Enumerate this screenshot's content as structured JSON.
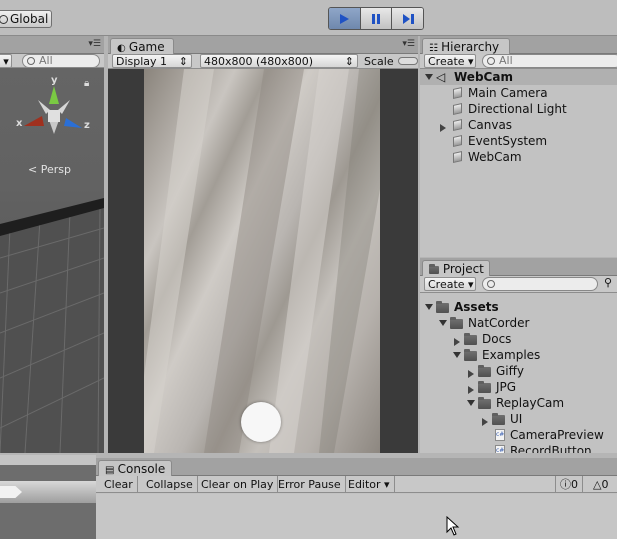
{
  "toolbar": {
    "global_label": "Global",
    "play_icon": "play-icon",
    "pause_icon": "pause-icon",
    "step_icon": "step-icon",
    "play_active_color": "#6f88ad"
  },
  "scene": {
    "search_placeholder": "All",
    "gizmo_axes": {
      "y": "y",
      "x": "x",
      "z": "z"
    },
    "projection_label": "Persp"
  },
  "game": {
    "tab_label": "Game",
    "display_value": "Display 1",
    "resolution_value": "480x800 (480x800)",
    "scale_label": "Scale"
  },
  "hierarchy": {
    "tab_label": "Hierarchy",
    "create_label": "Create",
    "search_placeholder": "All",
    "scene_name": "WebCam",
    "items": [
      {
        "label": "Main Camera",
        "expandable": false
      },
      {
        "label": "Directional Light",
        "expandable": false
      },
      {
        "label": "Canvas",
        "expandable": true
      },
      {
        "label": "EventSystem",
        "expandable": false
      },
      {
        "label": "WebCam",
        "expandable": false
      }
    ]
  },
  "project": {
    "tab_label": "Project",
    "create_label": "Create",
    "tree": [
      {
        "label": "Assets",
        "depth": 0,
        "kind": "folder",
        "expanded": true,
        "bold": true
      },
      {
        "label": "NatCorder",
        "depth": 1,
        "kind": "folder",
        "expanded": true
      },
      {
        "label": "Docs",
        "depth": 2,
        "kind": "folder",
        "expanded": false
      },
      {
        "label": "Examples",
        "depth": 2,
        "kind": "folder",
        "expanded": true
      },
      {
        "label": "Giffy",
        "depth": 3,
        "kind": "folder",
        "expanded": false
      },
      {
        "label": "JPG",
        "depth": 3,
        "kind": "folder",
        "expanded": false
      },
      {
        "label": "ReplayCam",
        "depth": 3,
        "kind": "folder",
        "expanded": true
      },
      {
        "label": "UI",
        "depth": 4,
        "kind": "folder",
        "expanded": false
      },
      {
        "label": "CameraPreview",
        "depth": 4,
        "kind": "script"
      },
      {
        "label": "RecordButton",
        "depth": 4,
        "kind": "script"
      }
    ]
  },
  "console": {
    "tab_label": "Console",
    "clear_label": "Clear",
    "collapse_label": "Collapse",
    "clear_on_play_label": "Clear on Play",
    "error_pause_label": "Error Pause",
    "editor_label": "Editor",
    "error_count": "0",
    "warning_count": "0"
  }
}
